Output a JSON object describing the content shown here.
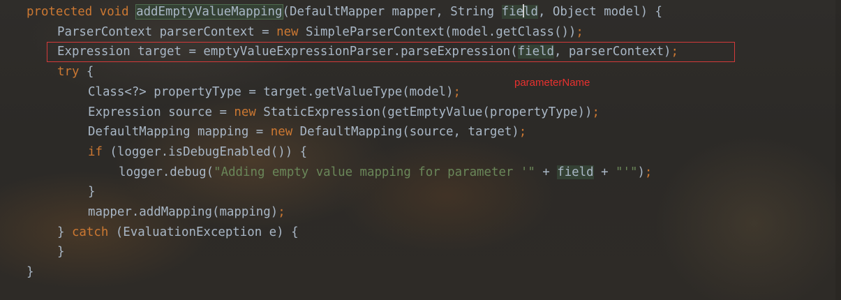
{
  "code_lines": {
    "l1": {
      "mod": "protected",
      "type": "void",
      "name": "addEmptyValueMapping",
      "p1": "(DefaultMapper mapper, String ",
      "param_a": "fie",
      "param_b": "ld",
      "p2": ", Object model) {"
    },
    "l2": {
      "a": "ParserContext parserContext = ",
      "kw": "new",
      "b": " SimpleParserContext(model.getClass())",
      "semi": ";"
    },
    "l3": {
      "a": "Expression target = emptyValueExpressionParser.parseExpression(",
      "field": "field",
      "b": ", parserContext)",
      "semi": ";"
    },
    "l4": {
      "kw": "try",
      "b": " {"
    },
    "l5": {
      "a": "Class<?> propertyType = target.getValueType(model)",
      "semi": ";"
    },
    "l6": {
      "a": "Expression source = ",
      "kw": "new",
      "b": " StaticExpression(getEmptyValue(propertyType))",
      "semi": ";"
    },
    "l7": {
      "a": "DefaultMapping mapping = ",
      "kw": "new",
      "b": " DefaultMapping(source, target)",
      "semi": ";"
    },
    "l8": {
      "kw": "if",
      "b": " (logger.isDebugEnabled()) {"
    },
    "l9": {
      "a": "logger.debug(",
      "str1": "\"Adding empty value mapping for parameter '\"",
      "b": " + ",
      "field": "field",
      "c": " + ",
      "str2": "\"'\"",
      "d": ")",
      "semi": ";"
    },
    "l10": {
      "a": "}"
    },
    "l11": {
      "a": "mapper.addMapping(mapping)",
      "semi": ";"
    },
    "l12": {
      "a": "} ",
      "kw": "catch",
      "b": " (EvaluationException e) {"
    },
    "l13": {
      "a": "}"
    },
    "l14": {
      "a": "}"
    }
  },
  "annotation": {
    "text": "parameterName",
    "color": "#e8312f"
  },
  "colors": {
    "keyword": "#cc7832",
    "string": "#6a8759",
    "default_text": "#a9b7c6",
    "highlight": "#344134",
    "box": "#d43a3a"
  }
}
